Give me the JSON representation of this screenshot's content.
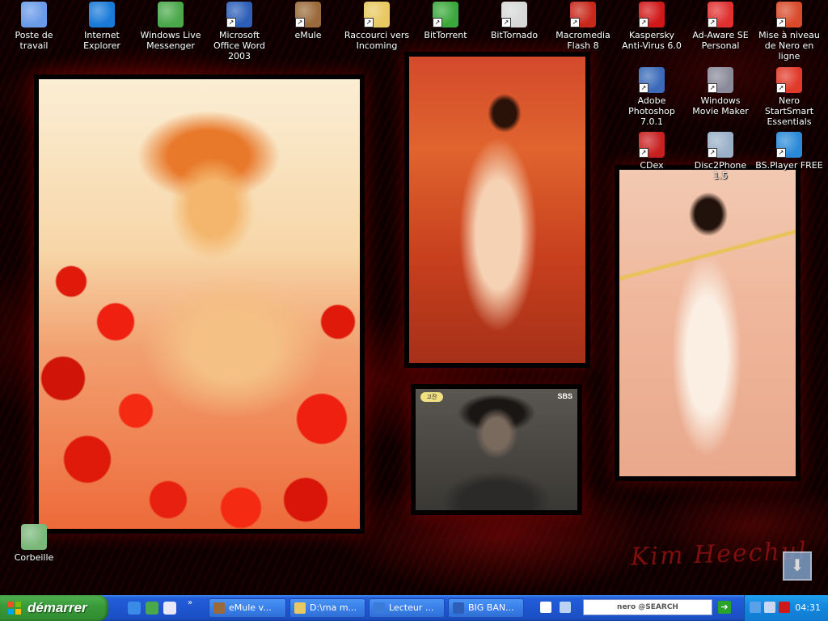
{
  "desktop": {
    "signature": "Kim Heechul",
    "photo4": {
      "corner_logo": "SBS",
      "channel_badge": "고잔"
    },
    "icons": [
      {
        "name": "poste-de-travail",
        "label": "Poste de travail",
        "shortcut": false,
        "color": "#6a9be8"
      },
      {
        "name": "internet-explorer",
        "label": "Internet Explorer",
        "shortcut": false,
        "color": "#1a7ad8"
      },
      {
        "name": "windows-live-messenger",
        "label": "Windows Live Messenger",
        "shortcut": false,
        "color": "#4aa84a"
      },
      {
        "name": "microsoft-office-word-2003",
        "label": "Microsoft Office Word 2003",
        "shortcut": true,
        "color": "#2d5fb8"
      },
      {
        "name": "emule",
        "label": "eMule",
        "shortcut": true,
        "color": "#9a6a3a"
      },
      {
        "name": "raccourci-vers-incoming",
        "label": "Raccourci vers Incoming",
        "shortcut": true,
        "color": "#e8c860"
      },
      {
        "name": "bittorrent",
        "label": "BitTorrent",
        "shortcut": true,
        "color": "#3aa83a"
      },
      {
        "name": "bittornado",
        "label": "BitTornado",
        "shortcut": true,
        "color": "#d8d8d8"
      },
      {
        "name": "macromedia-flash-8",
        "label": "Macromedia Flash 8",
        "shortcut": true,
        "color": "#c8281a"
      },
      {
        "name": "kaspersky-anti-virus",
        "label": "Kaspersky Anti-Virus 6.0",
        "shortcut": true,
        "color": "#d01818"
      },
      {
        "name": "ad-aware-se-personal",
        "label": "Ad-Aware SE Personal",
        "shortcut": true,
        "color": "#e03030"
      },
      {
        "name": "mise-a-niveau-nero",
        "label": "Mise à niveau de Nero en ligne",
        "shortcut": true,
        "color": "#d84a2a"
      },
      {
        "name": "adobe-photoshop",
        "label": "Adobe Photoshop 7.0.1",
        "shortcut": true,
        "color": "#3a6ab8"
      },
      {
        "name": "windows-movie-maker",
        "label": "Windows Movie Maker",
        "shortcut": true,
        "color": "#8a8a9a"
      },
      {
        "name": "nero-startsmart",
        "label": "Nero StartSmart Essentials",
        "shortcut": true,
        "color": "#e03a2a"
      },
      {
        "name": "cdex",
        "label": "CDex",
        "shortcut": true,
        "color": "#c82020"
      },
      {
        "name": "disc2phone",
        "label": "Disc2Phone 1.5",
        "shortcut": true,
        "color": "#9ab0c8"
      },
      {
        "name": "bs-player-free",
        "label": "BS.Player FREE",
        "shortcut": true,
        "color": "#2a8ad8"
      },
      {
        "name": "corbeille",
        "label": "Corbeille",
        "shortcut": false,
        "color": "#7ab87a"
      }
    ]
  },
  "taskbar": {
    "start_label": "démarrer",
    "quicklaunch": [
      {
        "name": "ie-quicklaunch-icon",
        "color": "#3a8ae8"
      },
      {
        "name": "messenger-quicklaunch-icon",
        "color": "#4aa84a"
      },
      {
        "name": "media-quicklaunch-icon",
        "color": "#e8e8f8"
      }
    ],
    "overflow_chevron": "»",
    "tasks": [
      {
        "name": "task-emule",
        "label": "eMule v...",
        "icon_color": "#9a6a3a"
      },
      {
        "name": "task-explorer",
        "label": "D:\\ma m...",
        "icon_color": "#e8c860"
      },
      {
        "name": "task-lecteur",
        "label": "Lecteur ...",
        "icon_color": "#3a7ad8"
      },
      {
        "name": "task-bigbang",
        "label": "BIG BAN...",
        "icon_color": "#2d5fb8"
      }
    ],
    "search_box": "nero @SEARCH",
    "go_arrow": "➔",
    "tray_icons": [
      {
        "name": "tray-back-icon",
        "color": "#5aa0e8"
      },
      {
        "name": "tray-network-icon",
        "color": "#c8d8f0"
      },
      {
        "name": "tray-kaspersky-icon",
        "color": "#d01818"
      }
    ],
    "clock": "04:31"
  }
}
